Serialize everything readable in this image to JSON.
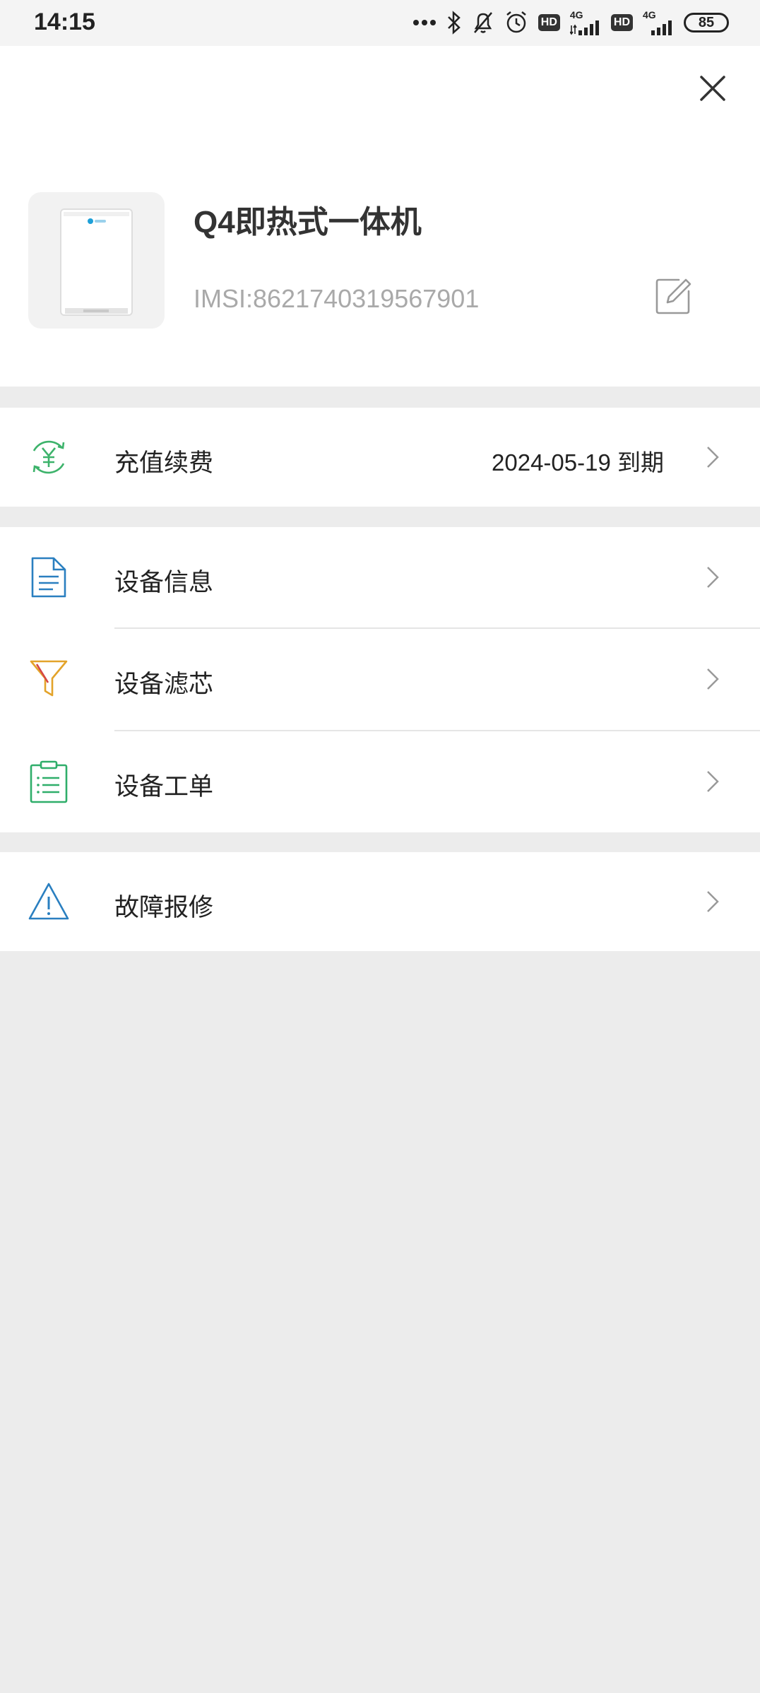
{
  "status_bar": {
    "time": "14:15",
    "network_label_1": "4G",
    "network_label_2": "4G",
    "hd_1": "HD",
    "hd_2": "HD",
    "battery": "85"
  },
  "device": {
    "name": "Q4即热式一体机",
    "imsi": "IMSI:8621740319567901"
  },
  "menu": {
    "recharge": {
      "label": "充值续费",
      "value": "2024-05-19 到期"
    },
    "info": {
      "label": "设备信息"
    },
    "filter": {
      "label": "设备滤芯"
    },
    "work_order": {
      "label": "设备工单"
    },
    "repair": {
      "label": "故障报修"
    }
  },
  "colors": {
    "recharge_icon": "#3db36b",
    "info_icon": "#2a7fc0",
    "filter_icon": "#e3a32a",
    "work_order_icon": "#2fae6a",
    "repair_icon": "#2a7fc0"
  }
}
